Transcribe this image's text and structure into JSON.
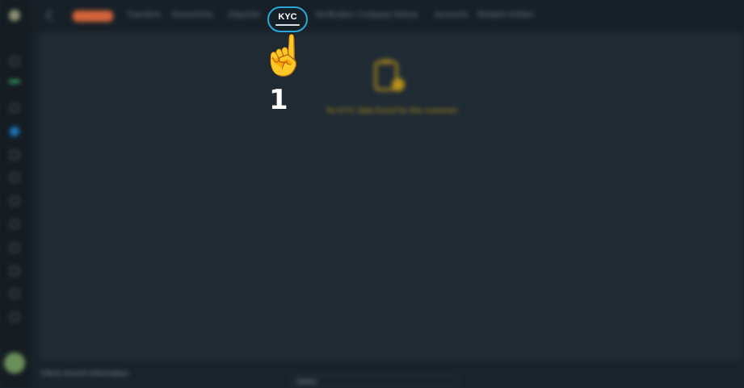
{
  "tabs": [
    {
      "label": "Overview",
      "highlight": true
    },
    {
      "label": "Transfers",
      "highlight": false
    },
    {
      "label": "Documents",
      "highlight": false
    },
    {
      "label": "Deposits",
      "highlight": false
    },
    {
      "label": "KYC",
      "active": true
    },
    {
      "label": "Verification",
      "highlight": false
    },
    {
      "label": "Company history",
      "highlight": false
    },
    {
      "label": "Accounts",
      "highlight": false
    },
    {
      "label": "Related entities",
      "highlight": false
    }
  ],
  "empty_state": {
    "text": "No KYC data found for this customer",
    "icon": "document-badge-icon"
  },
  "footer": {
    "text": "Client record information",
    "select_value": "Select"
  },
  "annotation": {
    "pointer": "☝️",
    "step": "1"
  },
  "colors": {
    "accent": "#2aa6d8",
    "warning": "#b8901a",
    "brand": "#d3643a"
  }
}
